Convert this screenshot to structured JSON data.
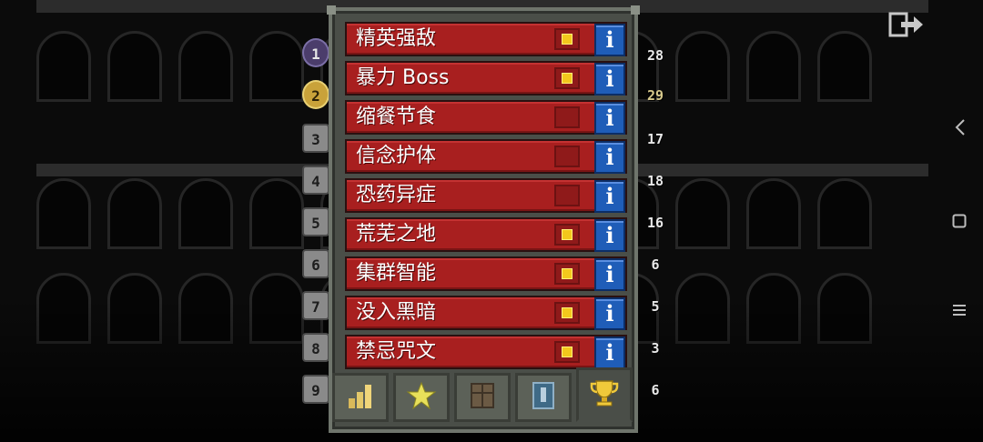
{
  "screen": {
    "exit_icon": "exit-door-icon"
  },
  "nav": {
    "back_icon": "back-chevron-icon",
    "home_icon": "home-square-icon",
    "menu_icon": "menu-lines-icon"
  },
  "ranks": [
    "1",
    "2",
    "3",
    "4",
    "5",
    "6",
    "7",
    "8",
    "9"
  ],
  "right_values": [
    "28",
    "29",
    "17",
    "18",
    "16",
    "6",
    "5",
    "3",
    "6"
  ],
  "challenges": [
    {
      "label": "精英强敌",
      "checked": true
    },
    {
      "label": "暴力 Boss",
      "checked": true
    },
    {
      "label": "缩餐节食",
      "checked": false
    },
    {
      "label": "信念护体",
      "checked": false
    },
    {
      "label": "恐药异症",
      "checked": false
    },
    {
      "label": "荒芜之地",
      "checked": true
    },
    {
      "label": "集群智能",
      "checked": true
    },
    {
      "label": "没入黑暗",
      "checked": true
    },
    {
      "label": "禁忌咒文",
      "checked": true
    }
  ],
  "info_label": "i",
  "tabs": [
    {
      "icon": "bar-chart-icon",
      "active": false
    },
    {
      "icon": "star-icon",
      "active": false
    },
    {
      "icon": "journal-book-icon",
      "active": false
    },
    {
      "icon": "badge-card-icon",
      "active": false
    },
    {
      "icon": "trophy-icon",
      "active": true
    }
  ],
  "colors": {
    "row_red": "#a81f1f",
    "check_gold": "#f3c81c",
    "info_blue": "#1f5db8",
    "panel": "#4a4e48"
  }
}
